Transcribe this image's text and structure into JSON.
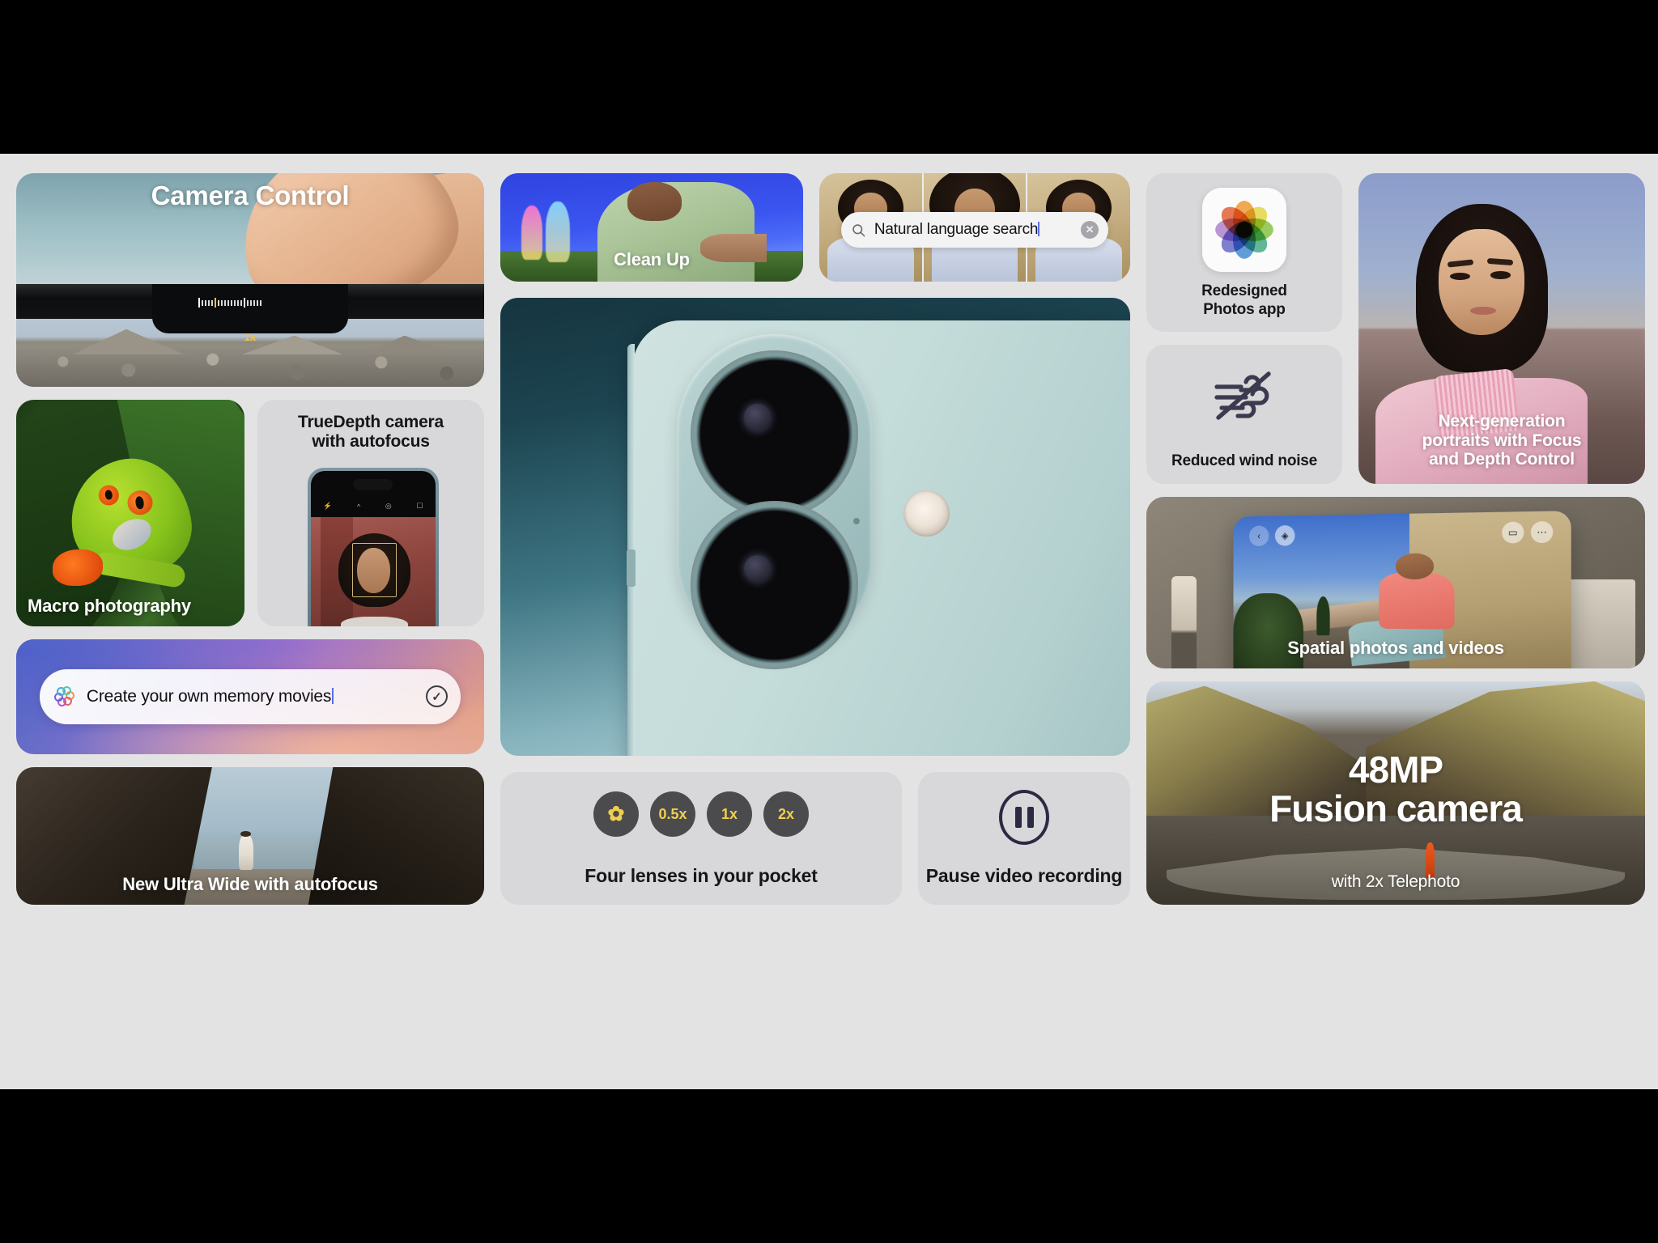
{
  "background": {
    "letterbox": "#000000",
    "slab": "#e4e3e4",
    "card_gray": "#d8d7d9"
  },
  "column_left": {
    "camera_control": {
      "title": "Camera Control",
      "zoom_label": "1x"
    },
    "macro": {
      "caption": "Macro photography"
    },
    "truedepth": {
      "title_line1": "TrueDepth camera",
      "title_line2": "with autofocus"
    },
    "memory_movies": {
      "text": "Create your own memory movies",
      "icon": "siri-glow-icon",
      "confirm_icon": "checkmark-circle-icon"
    },
    "ultra_wide": {
      "caption": "New Ultra Wide with autofocus"
    }
  },
  "column_center": {
    "clean_up": {
      "caption": "Clean Up"
    },
    "search": {
      "value": "Natural language search",
      "search_icon": "magnifier-icon",
      "clear_icon": "clear-circle-icon"
    },
    "hero_phone": {
      "alt": "iPhone 16 rear camera close-up"
    },
    "lenses": {
      "caption": "Four lenses in your pocket",
      "chips": [
        "✿",
        "0.5x",
        "1x",
        "2x"
      ]
    },
    "pause": {
      "caption": "Pause video recording",
      "icon": "pause-circle-icon"
    }
  },
  "column_right": {
    "photos_app": {
      "label_line1": "Redesigned",
      "label_line2": "Photos app",
      "icon": "photos-app-icon"
    },
    "wind_noise": {
      "label": "Reduced wind noise",
      "icon": "wind-slash-icon"
    },
    "portrait": {
      "caption_line1": "Next-generation",
      "caption_line2": "portraits with Focus",
      "caption_line3": "and Depth Control"
    },
    "spatial": {
      "caption": "Spatial photos and videos"
    },
    "fusion": {
      "headline_line1": "48MP",
      "headline_line2": "Fusion camera",
      "subhead": "with 2x Telephoto"
    }
  },
  "colors": {
    "chip_bg": "#4b4b4d",
    "chip_text": "#f1cf4e",
    "caret": "#5a6cf0",
    "pause_stroke": "#2a2a45",
    "wind_icon": "#3b3a4f"
  }
}
